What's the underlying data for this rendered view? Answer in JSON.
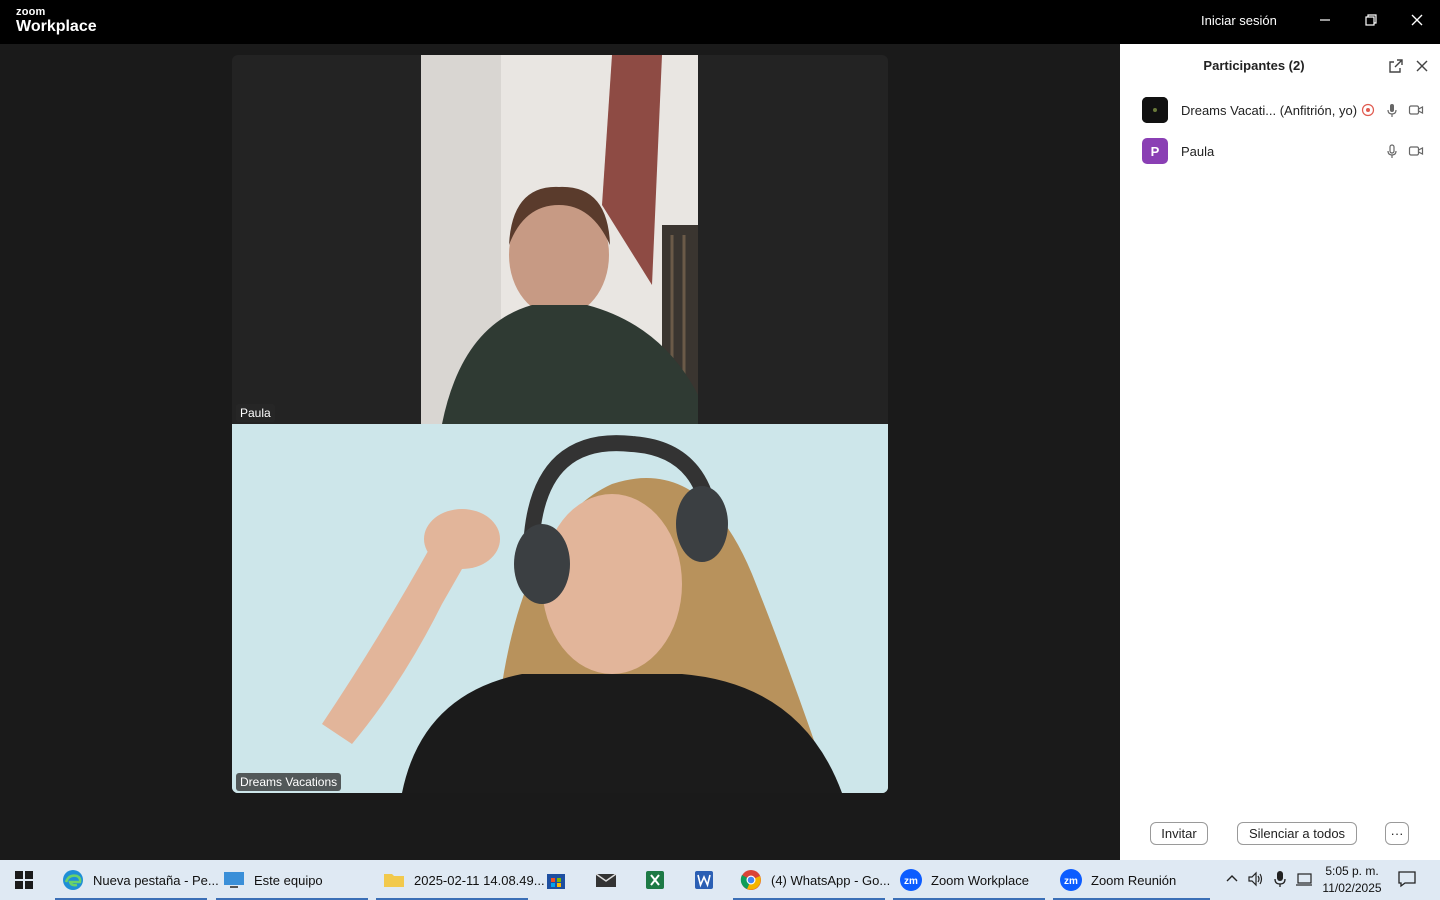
{
  "app": {
    "logo_small": "zoom",
    "logo_big": "Workplace",
    "signin_label": "Iniciar sesión"
  },
  "meeting": {
    "tiles": [
      {
        "name": "Paula"
      },
      {
        "name": "Dreams Vacations"
      }
    ]
  },
  "participants": {
    "title": "Participantes (2)",
    "rows": [
      {
        "name": "Dreams Vacati... (Anfitrión, yo)",
        "avatar_color": "#111111",
        "avatar_letter": ""
      },
      {
        "name": "Paula",
        "avatar_color": "#8a3fb4",
        "avatar_letter": "P"
      }
    ],
    "invite_label": "Invitar",
    "mute_all_label": "Silenciar a todos",
    "more_label": "···"
  },
  "taskbar": {
    "items": [
      {
        "label": "Nueva pestaña - Pe...",
        "icon": "edge-icon"
      },
      {
        "label": "Este equipo",
        "icon": "computer-icon"
      },
      {
        "label": "2025-02-11 14.08.49...",
        "icon": "folder-icon"
      },
      {
        "label": "",
        "icon": "store-icon"
      },
      {
        "label": "",
        "icon": "mail-icon"
      },
      {
        "label": "",
        "icon": "excel-icon"
      },
      {
        "label": "",
        "icon": "word-icon"
      },
      {
        "label": "(4) WhatsApp - Go...",
        "icon": "chrome-icon"
      },
      {
        "label": "Zoom Workplace",
        "icon": "zoom-icon"
      },
      {
        "label": "Zoom Reunión",
        "icon": "zoom-icon"
      }
    ],
    "time": "5:05 p. m.",
    "date": "11/02/2025"
  },
  "colors": {
    "accent": "#0b5cff",
    "taskbar_bg": "#dfe9f3",
    "panel_bg": "#ffffff"
  }
}
